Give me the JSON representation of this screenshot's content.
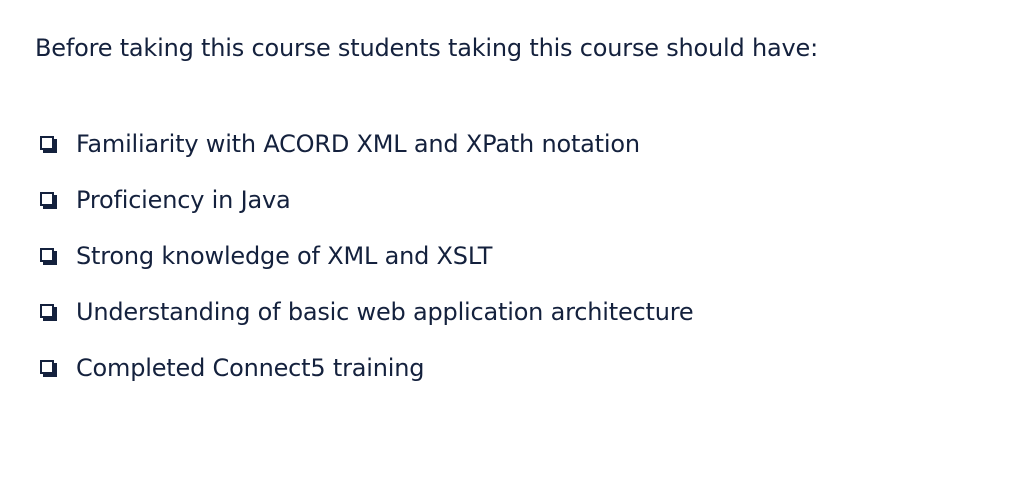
{
  "intro": "Before taking this course students taking this course should have:",
  "bullet_icon": "checkbox-square-icon",
  "text_color": "#14213d",
  "prerequisites": [
    "Familiarity with ACORD XML and XPath notation",
    "Proficiency in Java",
    "Strong knowledge of XML and XSLT",
    "Understanding of basic web application architecture",
    "Completed Connect5 training"
  ]
}
